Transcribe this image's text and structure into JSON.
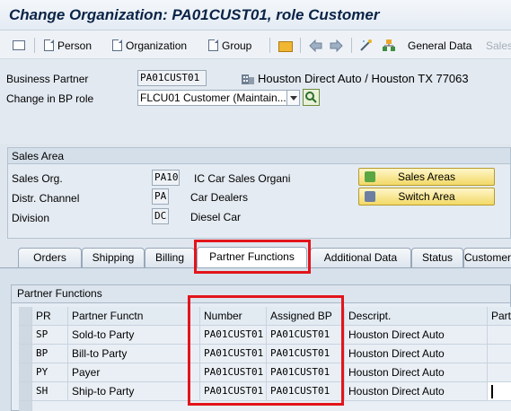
{
  "title": "Change Organization: PA01CUST01, role Customer",
  "toolbar": {
    "person": "Person",
    "organization": "Organization",
    "group": "Group",
    "general_data": "General Data",
    "sales": "Sales"
  },
  "header": {
    "bp_label": "Business Partner",
    "bp_value": "PA01CUST01",
    "bp_desc": "Houston Direct Auto / Houston TX 77063",
    "role_label": "Change in BP role",
    "role_value": "FLCU01 Customer (Maintain..."
  },
  "sales_area": {
    "title": "Sales Area",
    "sales_org_label": "Sales Org.",
    "sales_org_value": "PA10",
    "sales_org_desc": "IC Car Sales Organi",
    "channel_label": "Distr. Channel",
    "channel_value": "PA",
    "channel_desc": "Car Dealers",
    "division_label": "Division",
    "division_value": "DC",
    "division_desc": "Diesel Car",
    "btn_sales_areas": "Sales Areas",
    "btn_switch_area": "Switch Area"
  },
  "tabs": [
    "Orders",
    "Shipping",
    "Billing",
    "Partner Functions",
    "Additional Data",
    "Status",
    "Customer"
  ],
  "partner_functions": {
    "title": "Partner Functions",
    "columns": [
      "PR",
      "Partner Functn",
      "Number",
      "Assigned BP",
      "Descript.",
      "Part"
    ],
    "rows": [
      {
        "pr": "SP",
        "functn": "Sold-to Party",
        "number": "PA01CUST01",
        "assigned": "PA01CUST01",
        "desc": "Houston Direct Auto"
      },
      {
        "pr": "BP",
        "functn": "Bill-to Party",
        "number": "PA01CUST01",
        "assigned": "PA01CUST01",
        "desc": "Houston Direct Auto"
      },
      {
        "pr": "PY",
        "functn": "Payer",
        "number": "PA01CUST01",
        "assigned": "PA01CUST01",
        "desc": "Houston Direct Auto"
      },
      {
        "pr": "SH",
        "functn": "Ship-to Party",
        "number": "PA01CUST01",
        "assigned": "PA01CUST01",
        "desc": "Houston Direct Auto"
      }
    ]
  }
}
